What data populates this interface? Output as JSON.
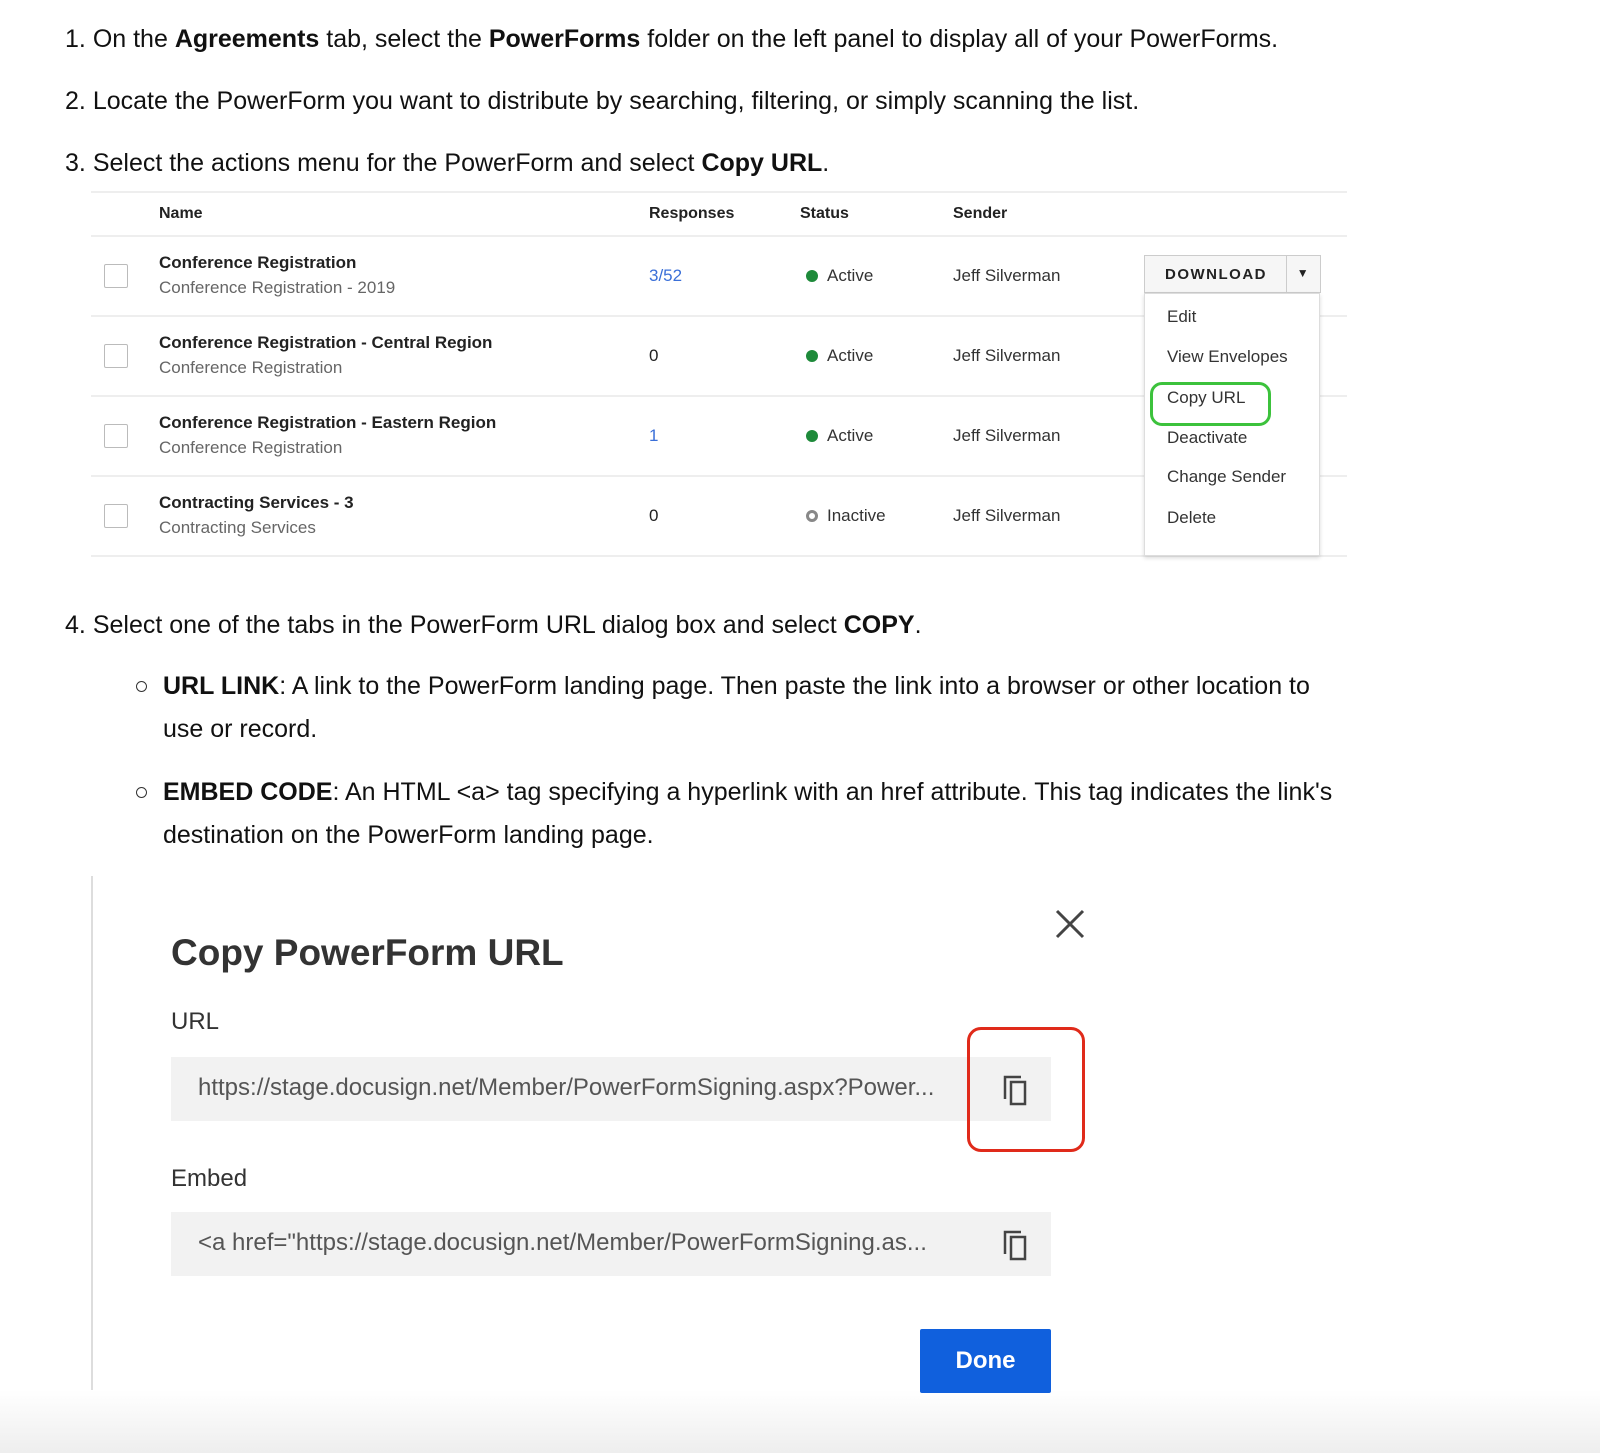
{
  "steps": {
    "s1": {
      "num": "1.",
      "pre": "On the ",
      "b1": "Agreements",
      "mid": " tab, select the ",
      "b2": "PowerForms",
      "post": " folder on the left panel to display all of your PowerForms."
    },
    "s2": {
      "num": "2.",
      "text": "Locate the PowerForm you want to distribute by searching, filtering, or simply scanning the list."
    },
    "s3": {
      "num": "3.",
      "pre": "Select the actions menu for the PowerForm and select ",
      "b": "Copy URL",
      "post": "."
    },
    "s4": {
      "num": "4.",
      "pre": "Select one of the tabs in the PowerForm URL dialog box and select ",
      "b": "COPY",
      "post": "."
    }
  },
  "bullets": [
    {
      "term": "URL LINK",
      "text": ": A link to the PowerForm landing page. Then paste the link into a browser or other location to use or record."
    },
    {
      "term": "EMBED CODE",
      "text": ": An HTML <a> tag specifying a hyperlink with an href attribute. This tag indicates the link's destination on the PowerForm landing page."
    }
  ],
  "table": {
    "headers": {
      "name": "Name",
      "responses": "Responses",
      "status": "Status",
      "sender": "Sender"
    },
    "rows": [
      {
        "name": "Conference Registration",
        "sub": "Conference Registration - 2019",
        "responses": "3/52",
        "status": "Active",
        "sender": "Jeff Silverman"
      },
      {
        "name": "Conference Registration - Central Region",
        "sub": "Conference Registration",
        "responses": "0",
        "status": "Active",
        "sender": "Jeff Silverman"
      },
      {
        "name": "Conference Registration - Eastern Region",
        "sub": "Conference Registration",
        "responses": "1",
        "status": "Active",
        "sender": "Jeff Silverman"
      },
      {
        "name": "Contracting Services - 3",
        "sub": "Contracting Services",
        "responses": "0",
        "status": "Inactive",
        "sender": "Jeff Silverman"
      }
    ],
    "download": "DOWNLOAD",
    "menu": [
      "Edit",
      "View Envelopes",
      "Copy URL",
      "Deactivate",
      "Change Sender",
      "Delete"
    ]
  },
  "dialog": {
    "title": "Copy PowerForm URL",
    "url_label": "URL",
    "url_value": "https://stage.docusign.net/Member/PowerFormSigning.aspx?Power...",
    "embed_label": "Embed",
    "embed_value": "<a href=\"https://stage.docusign.net/Member/PowerFormSigning.as...",
    "done": "Done"
  },
  "colors": {
    "accent": "#1060dd",
    "active": "#1e8a3a",
    "highlight_green": "#3cc23c",
    "highlight_red": "#e02a1a",
    "link": "#3a6fd8"
  }
}
